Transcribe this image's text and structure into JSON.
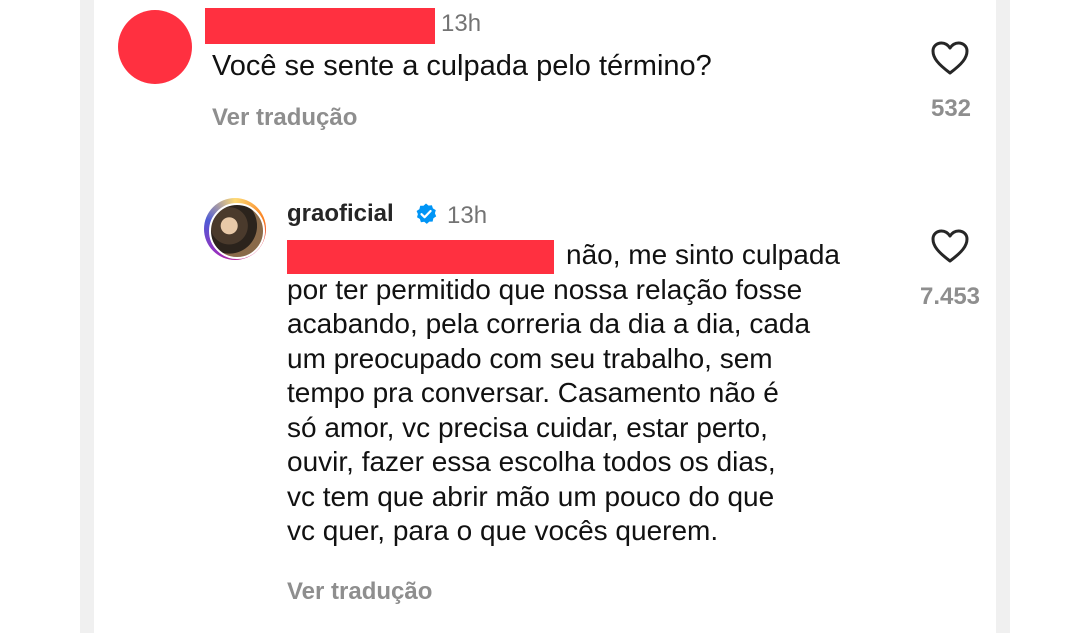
{
  "comment": {
    "time": "13h",
    "text": "Você se sente a culpada pelo término?",
    "translate_label": "Ver tradução",
    "likes": "532"
  },
  "reply": {
    "username": "graoficial",
    "time": "13h",
    "lines": [
      "não, me sinto culpada",
      "por ter permitido que nossa relação fosse",
      "acabando, pela correria da dia a dia, cada",
      "um preocupado com seu trabalho, sem",
      "tempo pra conversar. Casamento não é",
      "só amor, vc precisa cuidar, estar perto,",
      "ouvir, fazer essa escolha todos os dias,",
      "vc tem que abrir mão um pouco do que",
      "vc quer, para o que vocês querem."
    ],
    "translate_label": "Ver tradução",
    "likes": "7.453"
  },
  "colors": {
    "redaction": "#ff3040",
    "verified": "#0095f6",
    "muted_text": "#8e8e8e"
  },
  "icons": {
    "like": "heart-outline-icon",
    "verified": "verified-badge-icon"
  }
}
